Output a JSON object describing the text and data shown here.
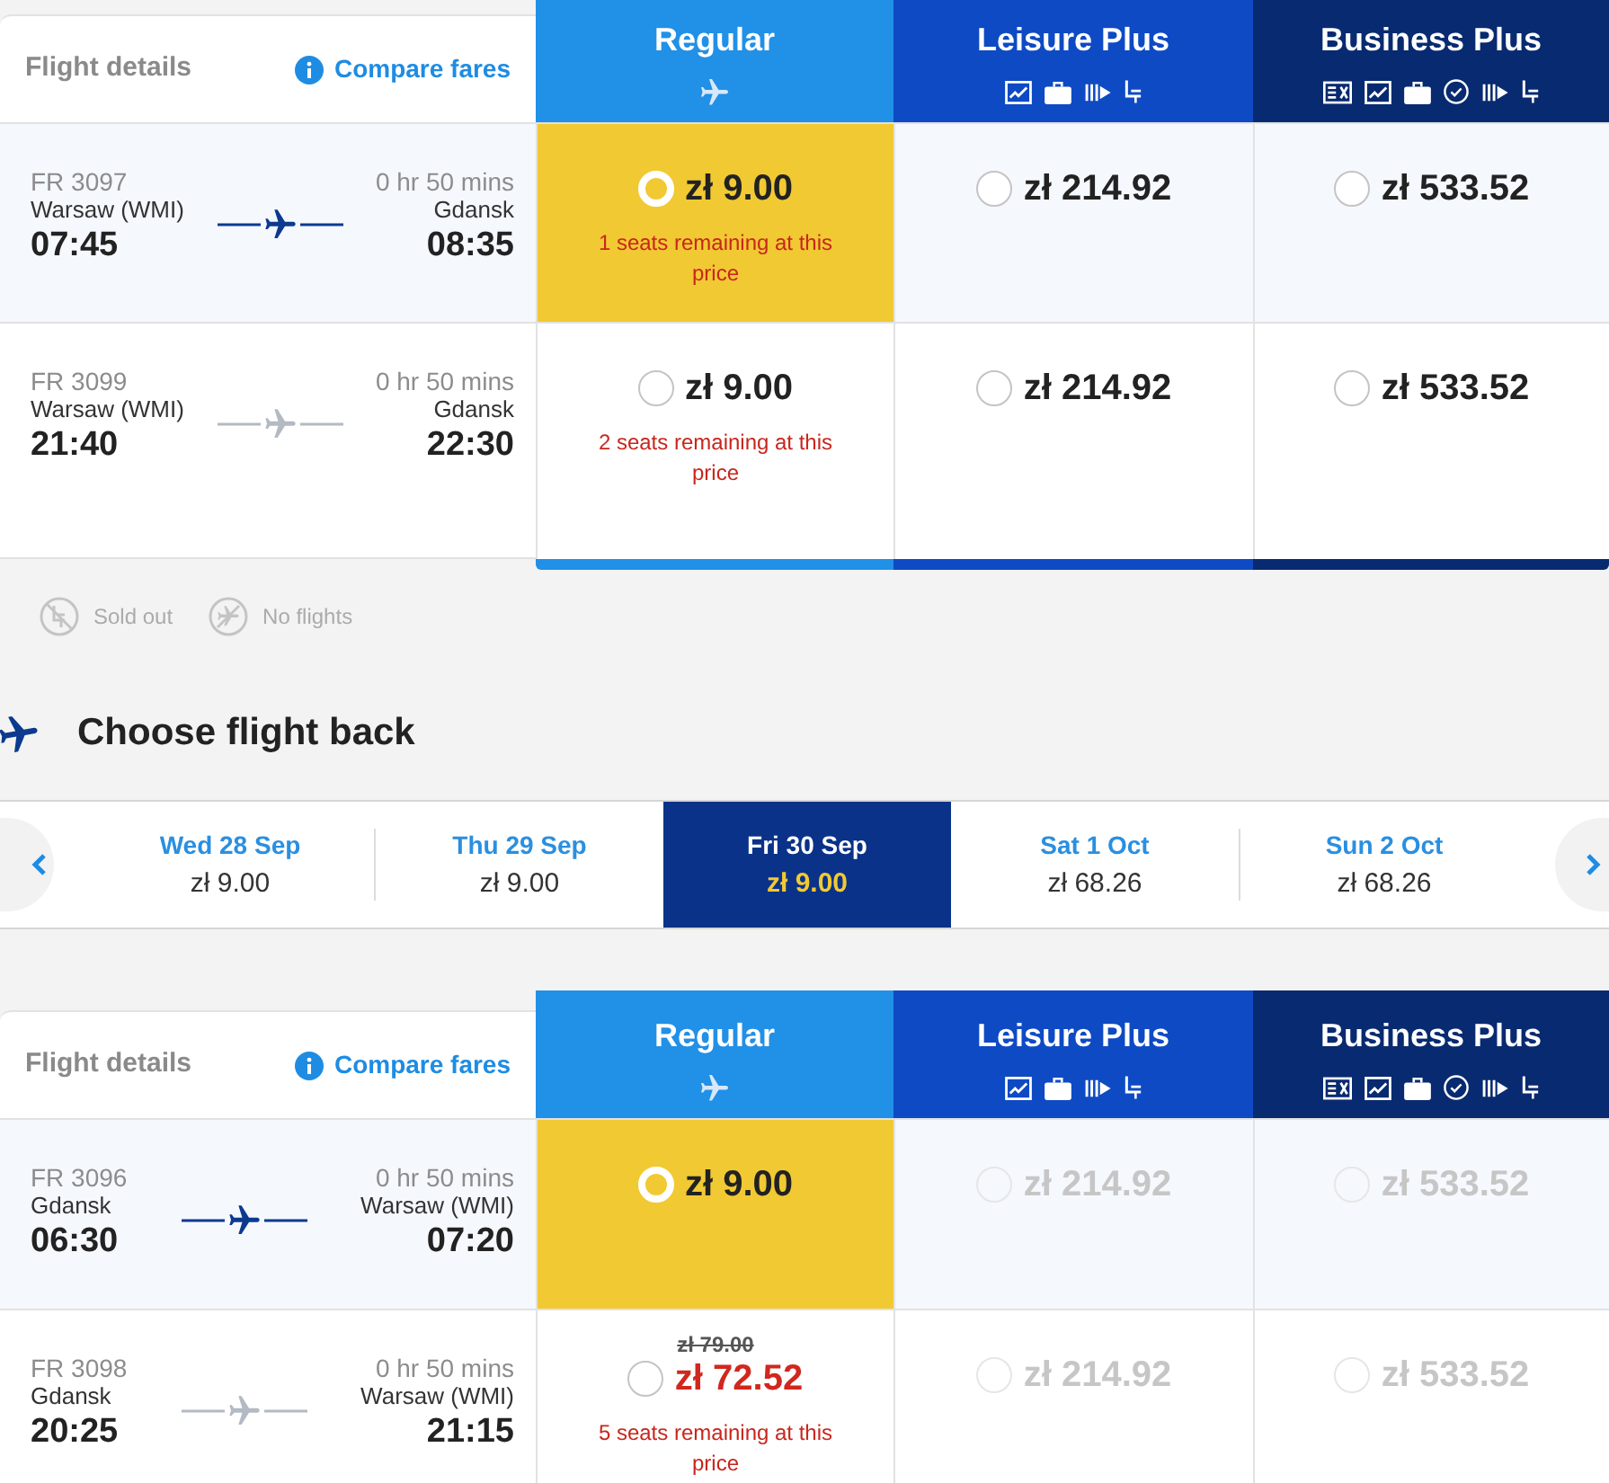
{
  "outbound": {
    "header": {
      "title": "Flight details",
      "link": "Compare fares"
    },
    "fares": [
      {
        "name": "Regular",
        "kind": "regular",
        "color": "#2190e7"
      },
      {
        "name": "Leisure Plus",
        "kind": "leisure",
        "color": "#0e4ac4"
      },
      {
        "name": "Business Plus",
        "kind": "business",
        "color": "#082a70"
      }
    ],
    "flights": [
      {
        "number": "FR 3097",
        "origin": "Warsaw (WMI)",
        "depart": "07:45",
        "duration": "0 hr 50 mins",
        "destination": "Gdansk",
        "arrive": "08:35",
        "selected": true,
        "prices": [
          {
            "price": "zł 9.00",
            "note": "1 seats remaining at this price",
            "selected": true,
            "disabled": false
          },
          {
            "price": "zł 214.92",
            "selected": false,
            "disabled": false
          },
          {
            "price": "zł 533.52",
            "selected": false,
            "disabled": false
          }
        ]
      },
      {
        "number": "FR 3099",
        "origin": "Warsaw (WMI)",
        "depart": "21:40",
        "duration": "0 hr 50 mins",
        "destination": "Gdansk",
        "arrive": "22:30",
        "selected": false,
        "prices": [
          {
            "price": "zł 9.00",
            "note": "2 seats remaining at this price",
            "selected": false,
            "disabled": false
          },
          {
            "price": "zł 214.92",
            "selected": false,
            "disabled": false
          },
          {
            "price": "zł 533.52",
            "selected": false,
            "disabled": false
          }
        ]
      }
    ]
  },
  "legend": [
    {
      "label": "Sold out",
      "kind": "sold-out"
    },
    {
      "label": "No flights",
      "kind": "no-flights"
    }
  ],
  "inbound": {
    "heading": "Choose flight back",
    "dates": [
      {
        "label": "Wed 28 Sep",
        "price": "zł 9.00",
        "selected": false
      },
      {
        "label": "Thu 29 Sep",
        "price": "zł 9.00",
        "selected": false
      },
      {
        "label": "Fri 30 Sep",
        "price": "zł 9.00",
        "selected": true
      },
      {
        "label": "Sat 1 Oct",
        "price": "zł 68.26",
        "selected": false
      },
      {
        "label": "Sun 2 Oct",
        "price": "zł 68.26",
        "selected": false
      }
    ],
    "header": {
      "title": "Flight details",
      "link": "Compare fares"
    },
    "fares": [
      {
        "name": "Regular",
        "kind": "regular",
        "color": "#2190e7"
      },
      {
        "name": "Leisure Plus",
        "kind": "leisure",
        "color": "#0e4ac4"
      },
      {
        "name": "Business Plus",
        "kind": "business",
        "color": "#082a70"
      }
    ],
    "flights": [
      {
        "number": "FR 3096",
        "origin": "Gdansk",
        "depart": "06:30",
        "duration": "0 hr 50 mins",
        "destination": "Warsaw (WMI)",
        "arrive": "07:20",
        "selected": true,
        "prices": [
          {
            "price": "zł 9.00",
            "selected": true,
            "disabled": false
          },
          {
            "price": "zł 214.92",
            "selected": false,
            "disabled": true
          },
          {
            "price": "zł 533.52",
            "selected": false,
            "disabled": true
          }
        ]
      },
      {
        "number": "FR 3098",
        "origin": "Gdansk",
        "depart": "20:25",
        "duration": "0 hr 50 mins",
        "destination": "Warsaw (WMI)",
        "arrive": "21:15",
        "selected": false,
        "prices": [
          {
            "old_price": "zł 79.00",
            "price": "zł 72.52",
            "note": "5 seats remaining at this price",
            "selected": false,
            "disabled": false
          },
          {
            "price": "zł 214.92",
            "selected": false,
            "disabled": true
          },
          {
            "price": "zł 533.52",
            "selected": false,
            "disabled": true
          }
        ]
      }
    ]
  }
}
